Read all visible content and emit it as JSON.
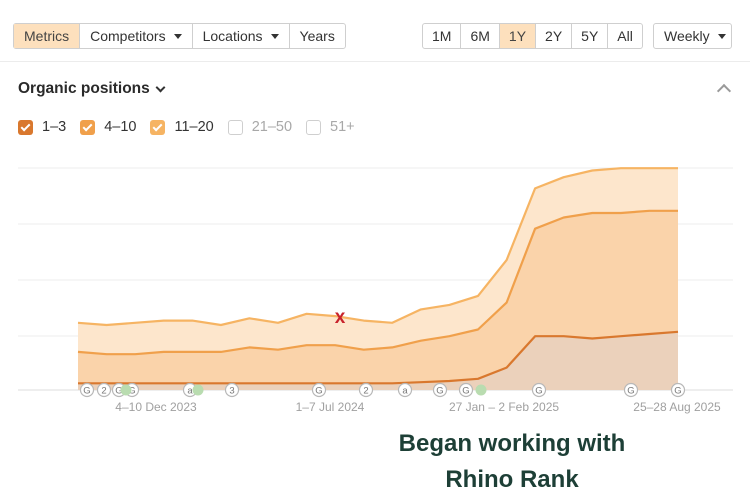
{
  "toolbar": {
    "left_tabs": [
      {
        "label": "Metrics",
        "active": true,
        "dropdown": false
      },
      {
        "label": "Competitors",
        "active": false,
        "dropdown": true
      },
      {
        "label": "Locations",
        "active": false,
        "dropdown": true
      },
      {
        "label": "Years",
        "active": false,
        "dropdown": false
      }
    ],
    "ranges": [
      {
        "label": "1M",
        "active": false
      },
      {
        "label": "6M",
        "active": false
      },
      {
        "label": "1Y",
        "active": true
      },
      {
        "label": "2Y",
        "active": false
      },
      {
        "label": "5Y",
        "active": false
      },
      {
        "label": "All",
        "active": false
      }
    ],
    "interval": "Weekly"
  },
  "section": {
    "title": "Organic positions"
  },
  "legend": [
    {
      "label": "1–3",
      "checked": true,
      "color": "#d9782e"
    },
    {
      "label": "4–10",
      "checked": true,
      "color": "#f0a04b"
    },
    {
      "label": "11–20",
      "checked": true,
      "color": "#f6b463"
    },
    {
      "label": "21–50",
      "checked": false,
      "color": "#cfcfcf"
    },
    {
      "label": "51+",
      "checked": false,
      "color": "#cfcfcf"
    }
  ],
  "chart_data": {
    "type": "area",
    "x_labels": [
      "4–10 Dec 2023",
      "1–7 Jul 2024",
      "27 Jan – 2 Feb 2025",
      "25–28 Aug 2025"
    ],
    "ylim": [
      0,
      100
    ],
    "grid": true,
    "series": [
      {
        "name": "11–20",
        "color": "#f6b463",
        "values": [
          30,
          29,
          30,
          31,
          31,
          29,
          32,
          30,
          34,
          33,
          31,
          30,
          36,
          38,
          42,
          58,
          90,
          95,
          98,
          99,
          99,
          99
        ]
      },
      {
        "name": "4–10",
        "color": "#f0a04b",
        "values": [
          17,
          16,
          16,
          17,
          17,
          17,
          19,
          18,
          20,
          20,
          18,
          19,
          22,
          24,
          27,
          39,
          72,
          77,
          79,
          79,
          80,
          80
        ]
      },
      {
        "name": "1–3",
        "color": "#d9782e",
        "values": [
          3,
          3,
          3,
          3,
          3,
          3,
          3,
          3,
          3,
          3,
          3,
          3,
          3.5,
          4,
          5,
          10,
          24,
          24,
          23,
          24,
          25,
          26
        ]
      }
    ],
    "event_markers": [
      "G",
      "2",
      "G",
      "G",
      "a",
      "3",
      "G",
      "2",
      "a",
      "G",
      "G",
      "G",
      "G",
      "G"
    ],
    "highlight_marker": "x"
  },
  "annotation": {
    "line1": "Began working with",
    "line2": "Rhino Rank"
  },
  "colors": {
    "accent": "#fde0bd",
    "arrow": "#c8232c",
    "annotation_text": "#1d3f36"
  }
}
